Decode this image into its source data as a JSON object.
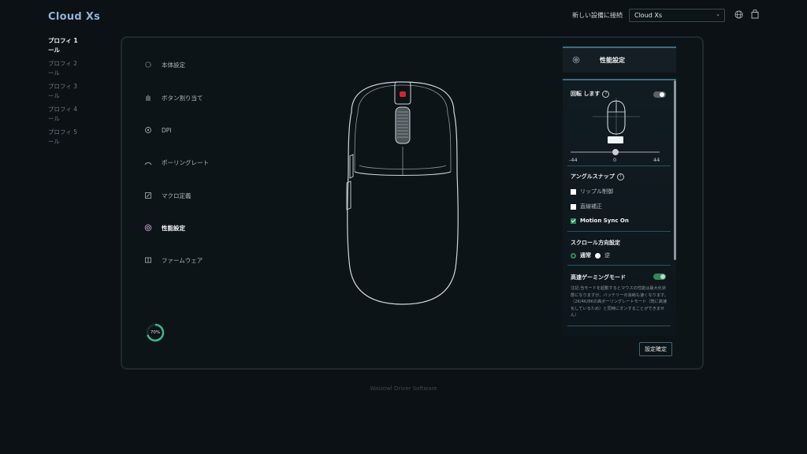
{
  "app": {
    "brand": "Cloud Xs"
  },
  "header": {
    "connect_label": "新しい設備に接続",
    "device_selected": "Cloud Xs",
    "icons": {
      "language": "globe-icon",
      "shop": "bag-icon"
    }
  },
  "profiles": [
    {
      "label": "プロフィ 1 ール",
      "active": true
    },
    {
      "label": "プロフィ 2 ール",
      "active": false
    },
    {
      "label": "プロフィ 3 ール",
      "active": false
    },
    {
      "label": "プロフィ 4 ール",
      "active": false
    },
    {
      "label": "プロフィ 5 ール",
      "active": false
    }
  ],
  "menu": [
    {
      "label": "本体設定",
      "icon": "settings-icon"
    },
    {
      "label": "ボタン割り当て",
      "icon": "button-assign-icon"
    },
    {
      "label": "DPI",
      "icon": "dpi-icon"
    },
    {
      "label": "ポーリングレート",
      "icon": "polling-rate-icon"
    },
    {
      "label": "マクロ定義",
      "icon": "macro-icon"
    },
    {
      "label": "性能設定",
      "icon": "performance-icon",
      "active": true
    },
    {
      "label": "ファームウェア",
      "icon": "firmware-icon"
    }
  ],
  "battery": {
    "percent_label": "70%",
    "value": 0.7
  },
  "side": {
    "title": "性能設定",
    "rotate": {
      "label": "回転 します",
      "help": "?",
      "enabled": false,
      "min_label": "-44",
      "max_label": "44",
      "center_label": "0",
      "value": 0
    },
    "angle_snap": {
      "label": "アングルスナップ",
      "help": "?",
      "options": [
        {
          "label": "リップル制御",
          "checked": false
        },
        {
          "label": "直線補正",
          "checked": false
        },
        {
          "label": "Motion Sync On",
          "checked": true
        }
      ]
    },
    "scroll": {
      "label": "スクロール方向設定",
      "normal": "通常",
      "reverse": "逆",
      "selected": "normal"
    },
    "gaming_mode": {
      "label": "高速ゲーミングモード",
      "enabled": true,
      "note": "注記:当モードを起動するとマウスの性能は最大化状態になりますが、バッテリーの消耗も速くなります。（2K/4K/8Kの高ポーリングレートモード（既に高速化しているため）と同時にオンすることができません）"
    }
  },
  "confirm_label": "設定確定",
  "footer": "Waizowl Driver Software",
  "colors": {
    "accent": "#2f8a57",
    "brand": "#8fb4d6",
    "line": "#3b6f80"
  }
}
